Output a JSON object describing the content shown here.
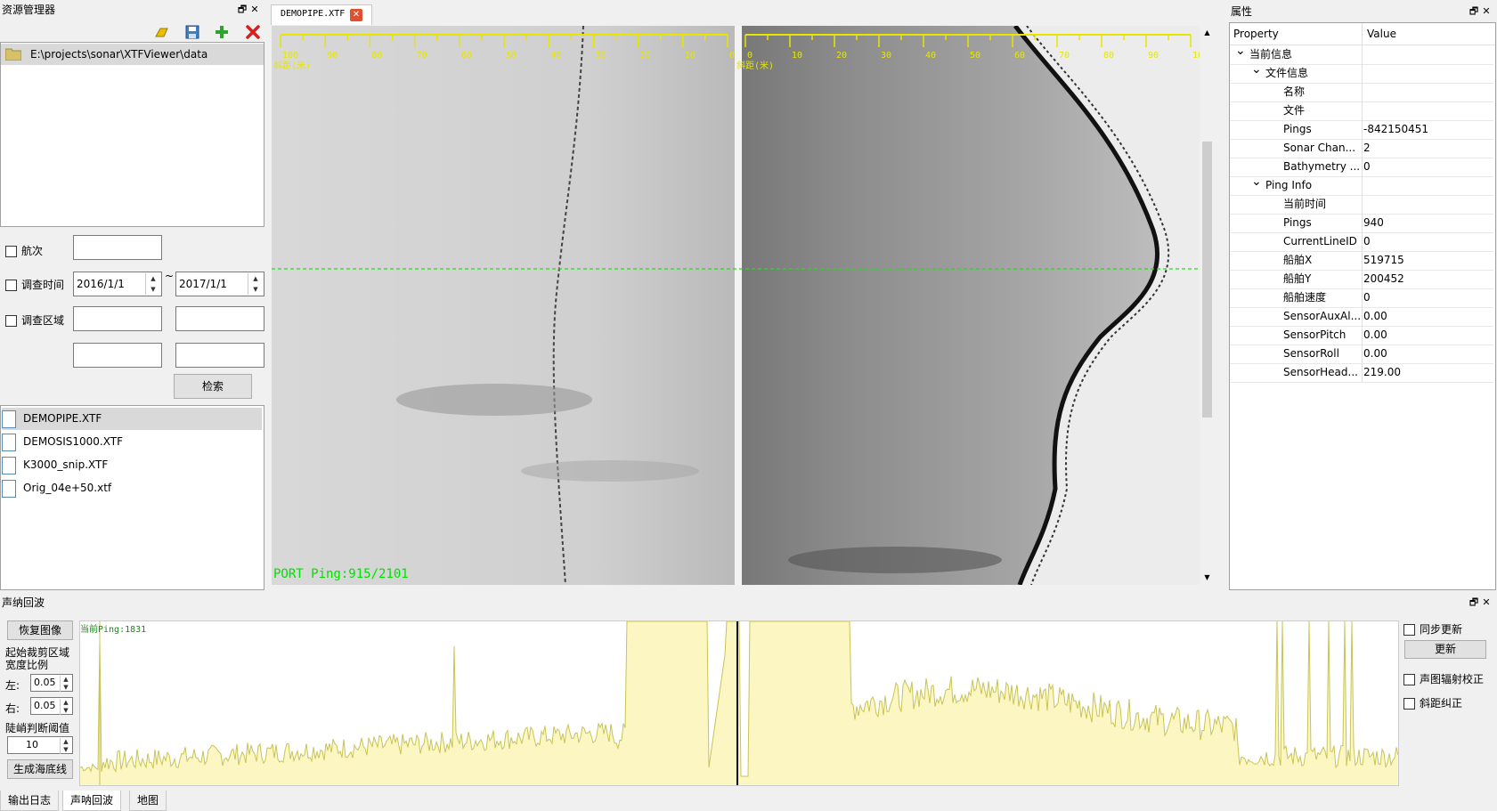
{
  "resource_manager": {
    "title": "资源管理器",
    "folder_path": "E:\\projects\\sonar\\XTFViewer\\data",
    "filters": {
      "voyage_label": "航次",
      "survey_time_label": "调查时间",
      "date_from": "2016/1/1",
      "date_sep": "~",
      "date_to": "2017/1/1",
      "survey_area_label": "调查区域",
      "search_label": "检索"
    },
    "files": [
      "DEMOPIPE.XTF",
      "DEMOSIS1000.XTF",
      "K3000_snip.XTF",
      "Orig_04e+50.xtf"
    ]
  },
  "viewer": {
    "tab_label": "DEMOPIPE.XTF",
    "status_text": "PORT Ping:915/2101",
    "left_scale_labels": [
      "100",
      "90",
      "80",
      "70",
      "60",
      "50",
      "40",
      "30",
      "20",
      "10",
      "0"
    ],
    "right_scale_labels": [
      "0",
      "10",
      "20",
      "30",
      "40",
      "50",
      "60",
      "70",
      "80",
      "90",
      "100"
    ],
    "left_unit": "斜距(米)",
    "right_unit": "斜距(米)"
  },
  "properties": {
    "title": "属性",
    "header_property": "Property",
    "header_value": "Value",
    "rows": [
      {
        "key": "当前信息",
        "value": "",
        "level": 0,
        "group": true
      },
      {
        "key": "文件信息",
        "value": "",
        "level": 1,
        "group": true
      },
      {
        "key": "名称",
        "value": "",
        "level": 2
      },
      {
        "key": "文件",
        "value": "",
        "level": 2
      },
      {
        "key": "Pings",
        "value": "-842150451",
        "level": 2
      },
      {
        "key": "Sonar Chan...",
        "value": "2",
        "level": 2
      },
      {
        "key": "Bathymetry ...",
        "value": "0",
        "level": 2
      },
      {
        "key": "Ping Info",
        "value": "",
        "level": 1,
        "group": true
      },
      {
        "key": "当前时间",
        "value": "",
        "level": 2
      },
      {
        "key": "Pings",
        "value": "940",
        "level": 2
      },
      {
        "key": "CurrentLineID",
        "value": "0",
        "level": 2
      },
      {
        "key": "船舶X",
        "value": "519715",
        "level": 2
      },
      {
        "key": "船舶Y",
        "value": "200452",
        "level": 2
      },
      {
        "key": "船舶速度",
        "value": "0",
        "level": 2
      },
      {
        "key": "SensorAuxAl...",
        "value": "0.00",
        "level": 2
      },
      {
        "key": "SensorPitch",
        "value": "0.00",
        "level": 2
      },
      {
        "key": "SensorRoll",
        "value": "0.00",
        "level": 2
      },
      {
        "key": "SensorHead...",
        "value": "219.00",
        "level": 2
      }
    ]
  },
  "echo": {
    "title": "声纳回波",
    "restore_label": "恢复图像",
    "crop_label_1": "起始裁剪区域",
    "crop_label_2": "宽度比例",
    "left_label": "左:",
    "left_value": "0.05",
    "right_label": "右:",
    "right_value": "0.05",
    "threshold_label": "陡峭判断阈值",
    "threshold_value": "10",
    "gen_seabed_label": "生成海底线",
    "current_ping": "当前Ping:1831",
    "sync_update_label": "同步更新",
    "update_label": "更新",
    "radiometric_label": "声图辐射校正",
    "slant_label": "斜距纠正"
  },
  "bottom_tabs": [
    "输出日志",
    "声呐回波",
    "地图"
  ],
  "colors": {
    "scale_yellow": "#e6e600",
    "status_green": "#00e000",
    "echo_fill": "#fbf6c2",
    "echo_line": "#c8c456"
  }
}
